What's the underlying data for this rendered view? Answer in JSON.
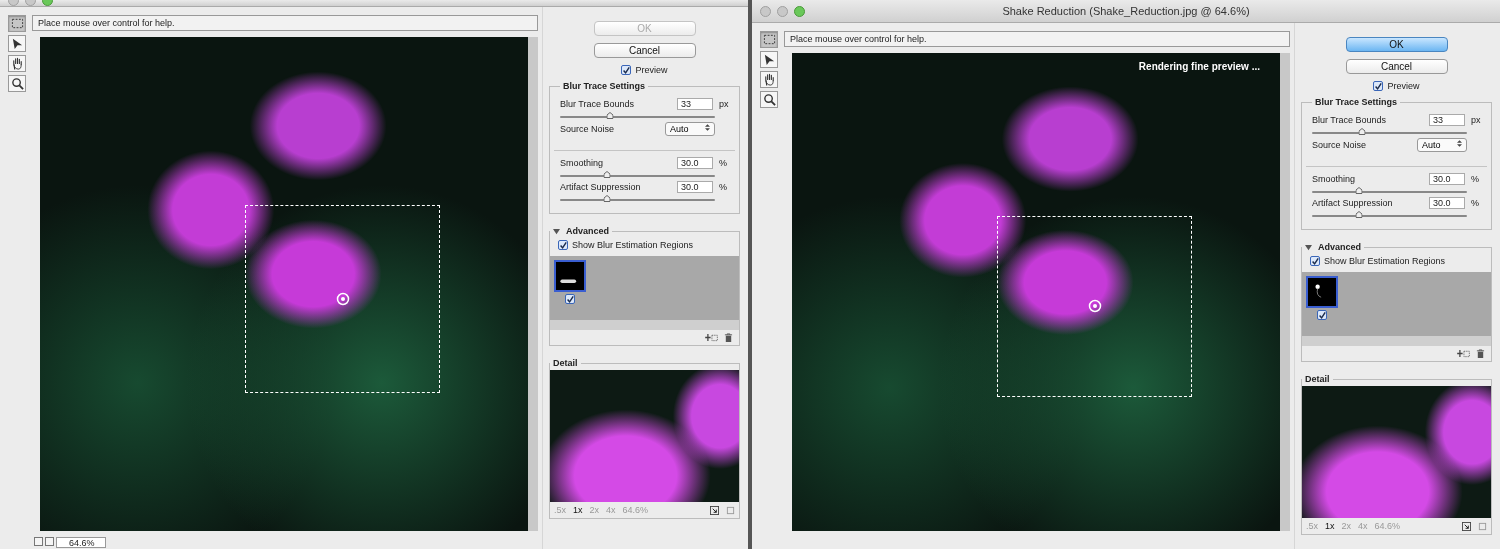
{
  "dialogs": [
    {
      "help": "Place mouse over control for help.",
      "tools": [
        {
          "kind": "marquee",
          "selected": true
        },
        {
          "kind": "arrow",
          "selected": false
        },
        {
          "kind": "hand",
          "selected": false
        },
        {
          "kind": "zoom",
          "selected": false
        }
      ],
      "ok": {
        "label": "OK",
        "disabled": true,
        "default": false
      },
      "cancel": {
        "label": "Cancel"
      },
      "preview": {
        "label": "Preview",
        "checked": true
      },
      "blur_trace": {
        "title": "Blur Trace Settings",
        "rows": [
          {
            "kind": "slider",
            "label": "Blur Trace Bounds",
            "value": "33",
            "unit": "px",
            "level": 0.32
          },
          {
            "kind": "dropdown",
            "label": "Source Noise",
            "value": "Auto"
          },
          {
            "kind": "divider"
          },
          {
            "kind": "slider",
            "label": "Smoothing",
            "value": "30.0",
            "unit": "%",
            "level": 0.3
          },
          {
            "kind": "slider",
            "label": "Artifact Suppression",
            "value": "30.0",
            "unit": "%",
            "level": 0.3
          }
        ]
      },
      "advanced": {
        "title": "Advanced",
        "expanded": true,
        "show_regions": {
          "label": "Show Blur Estimation Regions",
          "checked": true
        },
        "regions": [
          {
            "kind": "stroke",
            "selected": true,
            "checked": true
          }
        ]
      },
      "detail": {
        "title": "Detail",
        "zoom_options": [
          {
            "label": ".5x",
            "selected": false
          },
          {
            "label": "1x",
            "selected": true
          },
          {
            "label": "2x",
            "selected": false
          },
          {
            "label": "4x",
            "selected": false
          }
        ],
        "zoom_reading": "64.6%"
      },
      "zoom_field": "64.6%"
    },
    {
      "title": "Shake Reduction (Shake_Reduction.jpg @ 64.6%)",
      "help": "Place mouse over control for help.",
      "status_overlay": "Rendering fine preview ...",
      "tools": [
        {
          "kind": "marquee",
          "selected": true
        },
        {
          "kind": "arrow",
          "selected": false
        },
        {
          "kind": "hand",
          "selected": false
        },
        {
          "kind": "zoom",
          "selected": false
        }
      ],
      "ok": {
        "label": "OK",
        "disabled": false,
        "default": true
      },
      "cancel": {
        "label": "Cancel"
      },
      "preview": {
        "label": "Preview",
        "checked": true
      },
      "blur_trace": {
        "title": "Blur Trace Settings",
        "rows": [
          {
            "kind": "slider",
            "label": "Blur Trace Bounds",
            "value": "33",
            "unit": "px",
            "level": 0.32
          },
          {
            "kind": "dropdown",
            "label": "Source Noise",
            "value": "Auto"
          },
          {
            "kind": "divider"
          },
          {
            "kind": "slider",
            "label": "Smoothing",
            "value": "30.0",
            "unit": "%",
            "level": 0.3
          },
          {
            "kind": "slider",
            "label": "Artifact Suppression",
            "value": "30.0",
            "unit": "%",
            "level": 0.3
          }
        ]
      },
      "advanced": {
        "title": "Advanced",
        "expanded": true,
        "show_regions": {
          "label": "Show Blur Estimation Regions",
          "checked": true
        },
        "regions": [
          {
            "kind": "hook",
            "selected": true,
            "checked": true
          }
        ]
      },
      "detail": {
        "title": "Detail",
        "zoom_options": [
          {
            "label": ".5x",
            "selected": false
          },
          {
            "label": "1x",
            "selected": true
          },
          {
            "label": "2x",
            "selected": false
          },
          {
            "label": "4x",
            "selected": false
          }
        ],
        "zoom_reading": "64.6%"
      }
    }
  ]
}
